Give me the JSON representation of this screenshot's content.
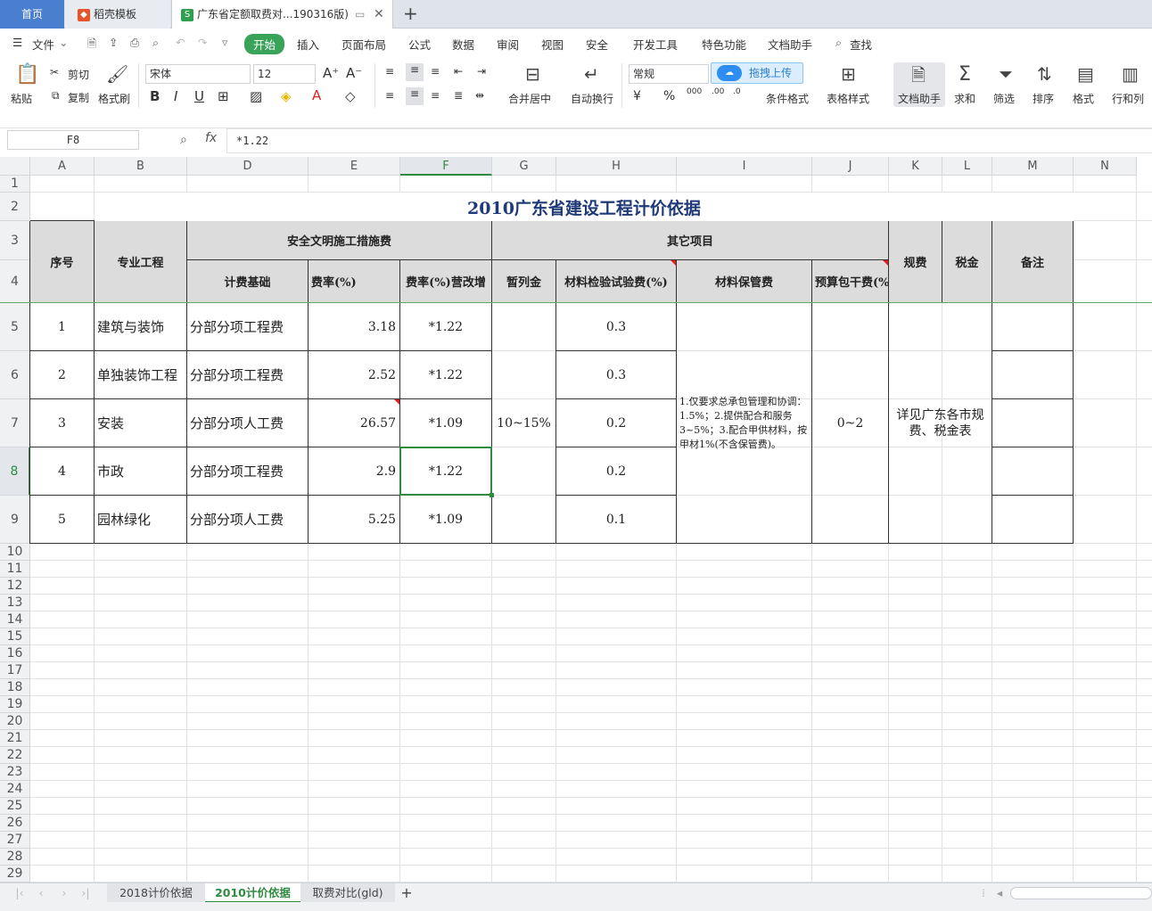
{
  "tabs": {
    "home": "首页",
    "template": "稻壳模板",
    "document": "广东省定额取费对...190316版)"
  },
  "menu": [
    "文件",
    "开始",
    "插入",
    "页面布局",
    "公式",
    "数据",
    "审阅",
    "视图",
    "安全",
    "开发工具",
    "特色功能",
    "文档助手",
    "查找"
  ],
  "ribbon": {
    "paste": "粘贴",
    "cut": "剪切",
    "copy": "复制",
    "format_painter": "格式刷",
    "font_name": "宋体",
    "font_size": "12",
    "merge_center": "合并居中",
    "wrap_text": "自动换行",
    "number_format": "常规",
    "upload": "拖拽上传",
    "cond_format": "条件格式",
    "table_style": "表格样式",
    "doc_assistant": "文档助手",
    "sum": "求和",
    "filter": "筛选",
    "sort": "排序",
    "format": "格式",
    "rows_cols": "行和列"
  },
  "formula_bar": {
    "cell_ref": "F8",
    "fx": "fx",
    "value": "*1.22"
  },
  "columns": [
    "A",
    "B",
    "D",
    "E",
    "F",
    "G",
    "H",
    "I",
    "J",
    "K",
    "L",
    "M",
    "N"
  ],
  "rows": [
    "1",
    "2",
    "3",
    "4",
    "5",
    "6",
    "7",
    "8",
    "9",
    "10",
    "11",
    "12",
    "13",
    "14",
    "15",
    "16",
    "17",
    "18",
    "19",
    "20",
    "21",
    "22",
    "23",
    "24",
    "25",
    "26",
    "27",
    "28",
    "29"
  ],
  "sheet": {
    "title": "2010广东省建设工程计价依据",
    "headers": {
      "seq": "序号",
      "specialty": "专业工程",
      "safety": "安全文明施工措施费",
      "basis": "计费基础",
      "rate": "费率(%)",
      "rate_vat": "费率(%)营改增",
      "other": "其它项目",
      "provisional": "暂列金",
      "material_test": "材料检验试验费(%)",
      "material_storage": "材料保管费",
      "budget_lump": "预算包干费(%",
      "regulatory": "规费",
      "tax": "税金",
      "remarks": "备注"
    },
    "data_rows": [
      {
        "seq": "1",
        "specialty": "建筑与装饰",
        "basis": "分部分项工程费",
        "rate": "3.18",
        "vat": "*1.22",
        "test": "0.3"
      },
      {
        "seq": "2",
        "specialty": "单独装饰工程",
        "basis": "分部分项工程费",
        "rate": "2.52",
        "vat": "*1.22",
        "test": "0.3"
      },
      {
        "seq": "3",
        "specialty": "安装",
        "basis": "分部分项人工费",
        "rate": "26.57",
        "vat": "*1.09",
        "test": "0.2"
      },
      {
        "seq": "4",
        "specialty": "市政",
        "basis": "分部分项工程费",
        "rate": "2.9",
        "vat": "*1.22",
        "test": "0.2"
      },
      {
        "seq": "5",
        "specialty": "园林绿化",
        "basis": "分部分项人工费",
        "rate": "5.25",
        "vat": "*1.09",
        "test": "0.1"
      }
    ],
    "provisional_value": "10~15%",
    "storage_note": "1.仅要求总承包管理和协调：1.5%；2.提供配合和服务3~5%；3.配合甲供材料，按甲材1%(不含保管费)。",
    "budget_value": "0~2",
    "fees_tax_note": "详见广东各市规费、税金表"
  },
  "sheet_tabs": [
    "2018计价依据",
    "2010计价依据",
    "取费对比(gld)"
  ],
  "colors": {
    "accent": "#3aa35a",
    "tab_active": "#4a7fd0",
    "header_fill": "#dcdcdc"
  }
}
